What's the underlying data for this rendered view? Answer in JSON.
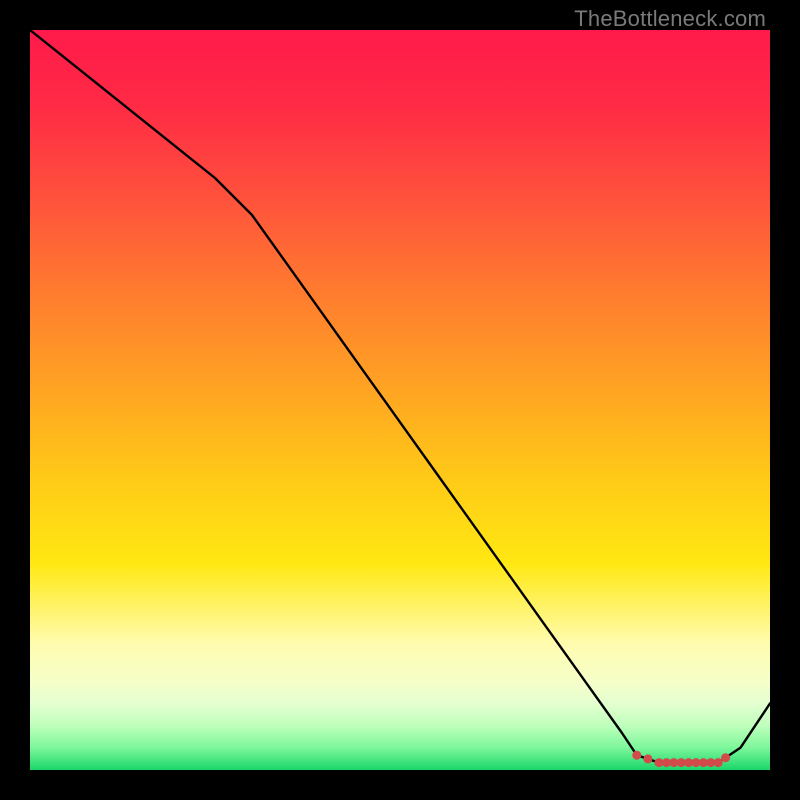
{
  "watermark": "TheBottleneck.com",
  "chart_data": {
    "type": "line",
    "title": "",
    "xlabel": "",
    "ylabel": "",
    "ylim": [
      0,
      100
    ],
    "xlim": [
      0,
      100
    ],
    "x": [
      0,
      5,
      10,
      15,
      20,
      25,
      30,
      35,
      40,
      45,
      50,
      55,
      60,
      65,
      70,
      75,
      80,
      82,
      85,
      88,
      91,
      93,
      96,
      100
    ],
    "values": [
      100,
      96,
      92,
      88,
      84,
      80,
      75,
      68,
      61,
      54,
      47,
      40,
      33,
      26,
      19,
      12,
      5,
      2,
      1,
      1,
      1,
      1,
      3,
      9
    ]
  }
}
